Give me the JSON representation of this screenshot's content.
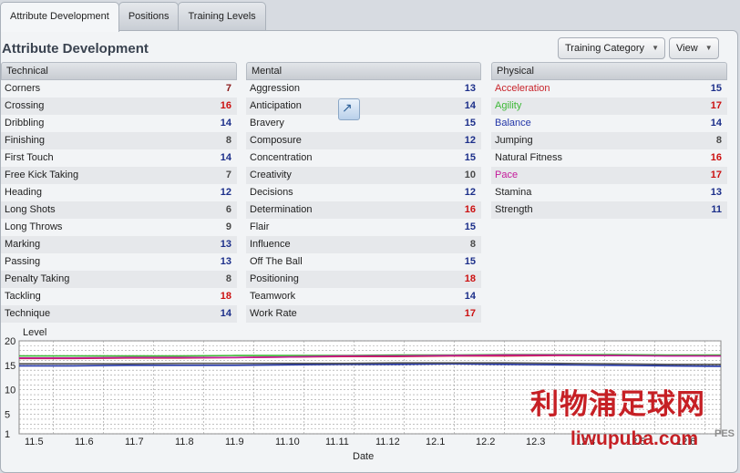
{
  "tabs": [
    "Attribute Development",
    "Positions",
    "Training Levels"
  ],
  "title": "Attribute Development",
  "buttons": {
    "training_category": "Training Category",
    "view": "View"
  },
  "columns": [
    {
      "header": "Technical",
      "rows": [
        {
          "name": "Corners",
          "value": "7",
          "color": "#8a1a1a"
        },
        {
          "name": "Crossing",
          "value": "16",
          "color": "#cc1111"
        },
        {
          "name": "Dribbling",
          "value": "14",
          "color": "#1c2f8a"
        },
        {
          "name": "Finishing",
          "value": "8",
          "color": "#4a4a4a"
        },
        {
          "name": "First Touch",
          "value": "14",
          "color": "#1c2f8a"
        },
        {
          "name": "Free Kick Taking",
          "value": "7",
          "color": "#4a4a4a"
        },
        {
          "name": "Heading",
          "value": "12",
          "color": "#1c2f8a"
        },
        {
          "name": "Long Shots",
          "value": "6",
          "color": "#4a4a4a"
        },
        {
          "name": "Long Throws",
          "value": "9",
          "color": "#4a4a4a"
        },
        {
          "name": "Marking",
          "value": "13",
          "color": "#1c2f8a"
        },
        {
          "name": "Passing",
          "value": "13",
          "color": "#1c2f8a"
        },
        {
          "name": "Penalty Taking",
          "value": "8",
          "color": "#4a4a4a"
        },
        {
          "name": "Tackling",
          "value": "18",
          "color": "#cc1111"
        },
        {
          "name": "Technique",
          "value": "14",
          "color": "#1c2f8a"
        }
      ]
    },
    {
      "header": "Mental",
      "rows": [
        {
          "name": "Aggression",
          "value": "13",
          "color": "#1c2f8a"
        },
        {
          "name": "Anticipation",
          "value": "14",
          "color": "#1c2f8a"
        },
        {
          "name": "Bravery",
          "value": "15",
          "color": "#1c2f8a"
        },
        {
          "name": "Composure",
          "value": "12",
          "color": "#1c2f8a"
        },
        {
          "name": "Concentration",
          "value": "15",
          "color": "#1c2f8a"
        },
        {
          "name": "Creativity",
          "value": "10",
          "color": "#4a4a4a"
        },
        {
          "name": "Decisions",
          "value": "12",
          "color": "#1c2f8a"
        },
        {
          "name": "Determination",
          "value": "16",
          "color": "#cc1111"
        },
        {
          "name": "Flair",
          "value": "15",
          "color": "#1c2f8a"
        },
        {
          "name": "Influence",
          "value": "8",
          "color": "#4a4a4a"
        },
        {
          "name": "Off The Ball",
          "value": "15",
          "color": "#1c2f8a"
        },
        {
          "name": "Positioning",
          "value": "18",
          "color": "#cc1111"
        },
        {
          "name": "Teamwork",
          "value": "14",
          "color": "#1c2f8a"
        },
        {
          "name": "Work Rate",
          "value": "17",
          "color": "#cc1111"
        }
      ]
    },
    {
      "header": "Physical",
      "rows": [
        {
          "name": "Acceleration",
          "value": "15",
          "color": "#1c2f8a",
          "name_color": "#c8242b"
        },
        {
          "name": "Agility",
          "value": "17",
          "color": "#cc1111",
          "name_color": "#3cb836"
        },
        {
          "name": "Balance",
          "value": "14",
          "color": "#1c2f8a",
          "name_color": "#2336a8"
        },
        {
          "name": "Jumping",
          "value": "8",
          "color": "#4a4a4a"
        },
        {
          "name": "Natural Fitness",
          "value": "16",
          "color": "#cc1111"
        },
        {
          "name": "Pace",
          "value": "17",
          "color": "#cc1111",
          "name_color": "#c41a9a"
        },
        {
          "name": "Stamina",
          "value": "13",
          "color": "#1c2f8a"
        },
        {
          "name": "Strength",
          "value": "11",
          "color": "#1c2f8a"
        }
      ]
    }
  ],
  "chart_data": {
    "type": "line",
    "ylabel": "Level",
    "xlabel": "Date",
    "ylim": [
      1,
      20
    ],
    "yticks": [
      "20",
      "15",
      "10",
      "5",
      "1"
    ],
    "categories": [
      "11.5",
      "11.6",
      "11.7",
      "11.8",
      "11.9",
      "11.10",
      "11.11",
      "11.12",
      "12.1",
      "12.2",
      "12.3",
      "12.4",
      "12.5",
      "12.6"
    ],
    "grid": true,
    "series": [
      {
        "name": "Acceleration",
        "color": "#c8242b",
        "values": [
          16.4,
          16.4,
          16.5,
          16.5,
          16.6,
          16.7,
          16.8,
          16.8,
          16.9,
          16.9,
          17.0,
          17.0,
          17.0,
          17.0
        ]
      },
      {
        "name": "Agility",
        "color": "#3cb836",
        "values": [
          16.9,
          16.9,
          16.9,
          16.9,
          17.0,
          17.0,
          17.0,
          17.1,
          17.1,
          17.2,
          17.2,
          17.2,
          17.1,
          17.1
        ]
      },
      {
        "name": "Balance",
        "color": "#2336a8",
        "values": [
          14.9,
          14.9,
          15.0,
          15.0,
          15.0,
          15.1,
          15.2,
          15.2,
          15.3,
          15.2,
          15.1,
          15.0,
          14.9,
          14.8
        ]
      },
      {
        "name": "Pace",
        "color": "#c41a9a",
        "values": [
          16.5,
          16.5,
          16.6,
          16.6,
          16.6,
          16.7,
          16.9,
          16.9,
          17.0,
          17.1,
          17.1,
          17.0,
          16.9,
          16.9
        ]
      },
      {
        "name": "Natural Fitness",
        "color": "#555555",
        "values": [
          15.3,
          15.3,
          15.3,
          15.4,
          15.4,
          15.4,
          15.4,
          15.5,
          15.5,
          15.5,
          15.4,
          15.3,
          15.2,
          15.2
        ]
      }
    ]
  },
  "watermark": {
    "cn": "利物浦足球网",
    "en": "liwupuba.com",
    "pes": "PES"
  }
}
